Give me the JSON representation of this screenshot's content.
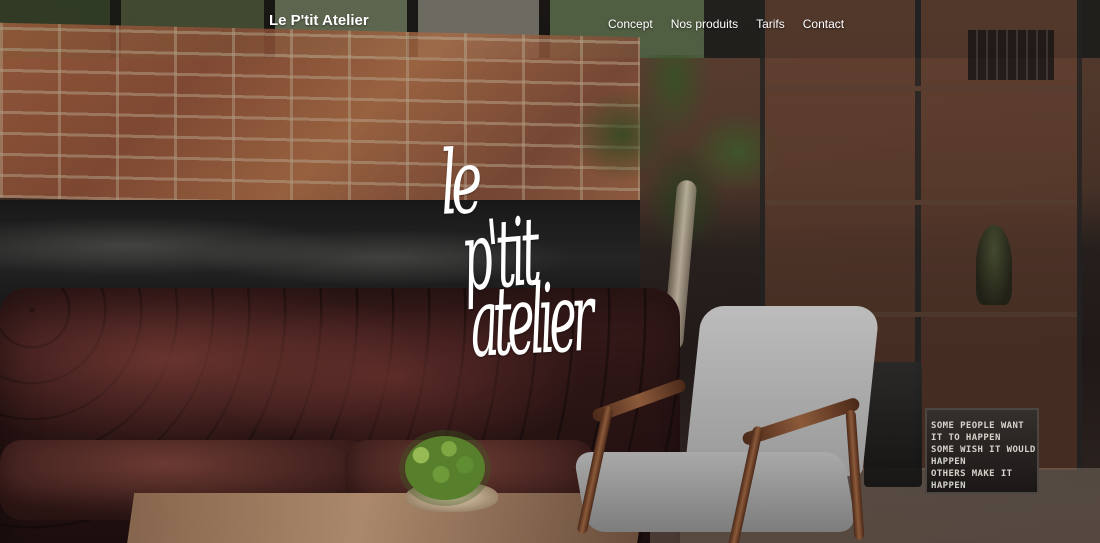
{
  "site": {
    "brand": "Le P'tit Atelier",
    "navigation": [
      {
        "label": "Concept"
      },
      {
        "label": "Nos produits"
      },
      {
        "label": "Tarifs"
      },
      {
        "label": "Contact"
      }
    ],
    "logo": {
      "line1": "le",
      "line2": "p'tit",
      "line3": "atelier"
    },
    "background_text": [
      "SOME PEOPLE WANT IT TO HAPPEN",
      "SOME WISH IT WOULD HAPPEN",
      "OTHERS MAKE IT HAPPEN"
    ]
  }
}
